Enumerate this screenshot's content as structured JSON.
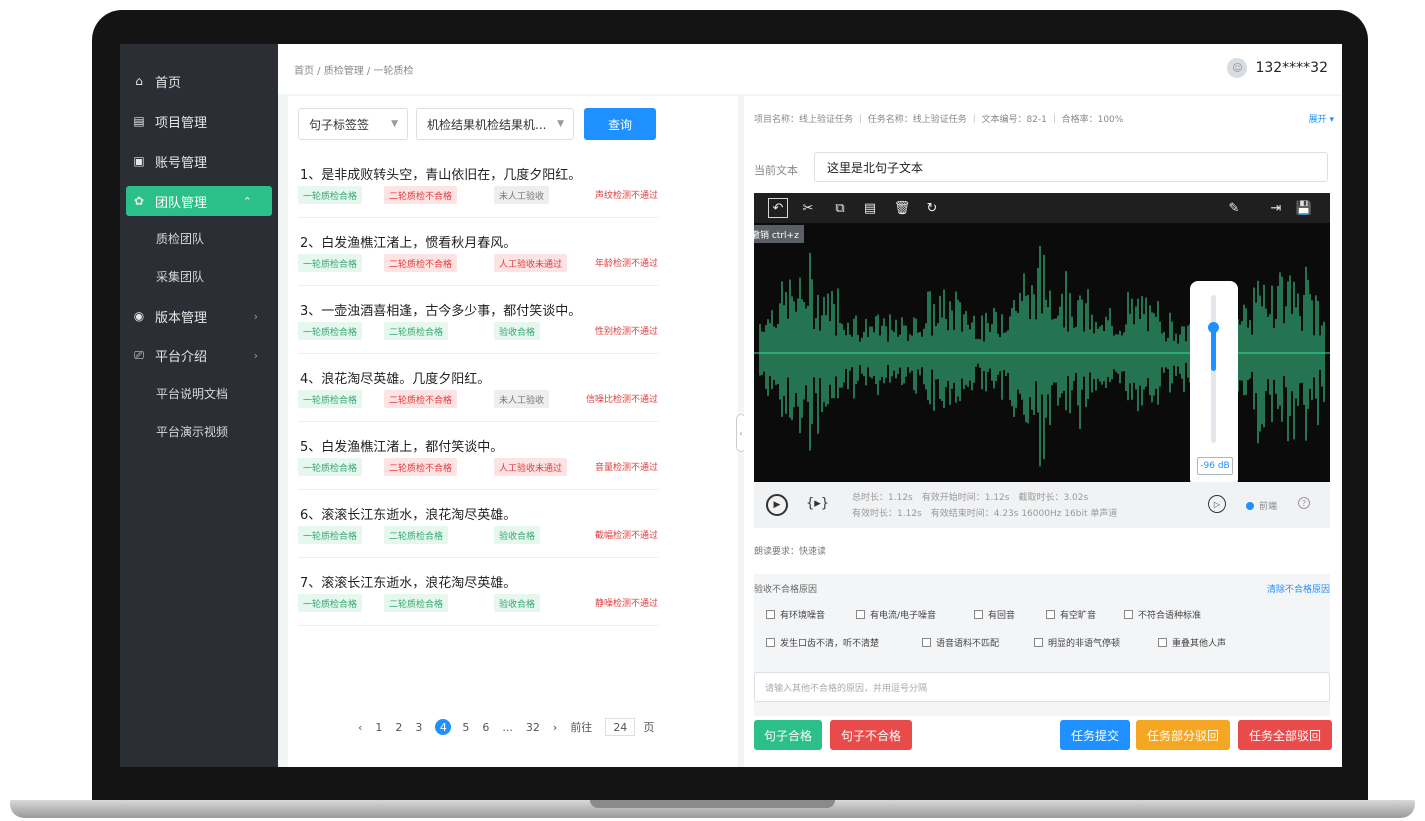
{
  "sidebar": {
    "items": [
      {
        "label": "首页",
        "icon": "home-icon"
      },
      {
        "label": "项目管理",
        "icon": "project-icon"
      },
      {
        "label": "账号管理",
        "icon": "account-icon"
      },
      {
        "label": "团队管理",
        "icon": "team-icon"
      },
      {
        "label": "质检团队"
      },
      {
        "label": "采集团队"
      },
      {
        "label": "版本管理",
        "icon": "version-icon"
      },
      {
        "label": "平台介绍",
        "icon": "platform-icon"
      },
      {
        "label": "平台说明文档"
      },
      {
        "label": "平台演示视频"
      }
    ],
    "active_color": "#2bbf8a"
  },
  "header": {
    "breadcrumb": "首页 / 质检管理 / 一轮质检",
    "user": "132****32"
  },
  "filter": {
    "select1": "句子标签签",
    "select2": "机检结果机检结果机...",
    "query": "查询"
  },
  "sentences": [
    {
      "text": "1、是非成败转头空，青山依旧在，几度夕阳红。",
      "tags": [
        "一轮质检合格",
        "二轮质检不合格",
        "未人工验收"
      ],
      "result": "声纹检测不通过"
    },
    {
      "text": "2、白发渔樵江渚上，惯看秋月春风。",
      "tags": [
        "一轮质检合格",
        "二轮质检不合格",
        "人工验收未通过"
      ],
      "result": "年龄检测不通过"
    },
    {
      "text": "3、一壶浊酒喜相逢，古今多少事，都付笑谈中。",
      "tags": [
        "一轮质检合格",
        "二轮质检合格",
        "验收合格"
      ],
      "result": "性别检测不通过"
    },
    {
      "text": "4、浪花淘尽英雄。几度夕阳红。",
      "tags": [
        "一轮质检合格",
        "二轮质检不合格",
        "未人工验收"
      ],
      "result": "信噪比检测不通过"
    },
    {
      "text": "5、白发渔樵江渚上，都付笑谈中。",
      "tags": [
        "一轮质检合格",
        "二轮质检不合格",
        "人工验收未通过"
      ],
      "result": "音量检测不通过"
    },
    {
      "text": "6、滚滚长江东逝水，浪花淘尽英雄。",
      "tags": [
        "一轮质检合格",
        "二轮质检合格",
        "验收合格"
      ],
      "result": "截幅检测不通过"
    },
    {
      "text": "7、滚滚长江东逝水，浪花淘尽英雄。",
      "tags": [
        "一轮质检合格",
        "二轮质检合格",
        "验收合格"
      ],
      "result": "静噪检测不通过"
    }
  ],
  "pager": {
    "pages": [
      "1",
      "2",
      "3",
      "4",
      "5",
      "6",
      "...",
      "32"
    ],
    "current": "4",
    "goto_label": "前往",
    "goto_value": "24",
    "page_unit": "页"
  },
  "detail": {
    "project": "项目名称：线上验证任务 ｜ 任务名称：线上验证任务 ｜ 文本编号：82-1 ｜ 合格率：100%",
    "expand": "展开",
    "current_label": "当前文本",
    "current_text": "这里是北句子文本",
    "tooltip": "撤销 ctrl+z",
    "db": "-96 dB",
    "stats_line1": "总时长：1.12s　有效开始时间：1.12s　截取时长：3.02s",
    "stats_line2": "有效时长：1.12s　有效结束时间：4.23s 16000Hz 16bit 单声道",
    "radio": "前端",
    "reading": "朗读要求：快速读",
    "reasons_title": "验收不合格原因",
    "clear": "清除不合格原因",
    "reasons": [
      "有环境噪音",
      "有电流/电子噪音",
      "有回音",
      "有空旷音",
      "不符合语种标准",
      "发生口齿不清，听不清楚",
      "语音语料不匹配",
      "明显的非语气停顿",
      "重叠其他人声"
    ],
    "other_placeholder": "请输入其他不合格的原因，并用逗号分隔"
  },
  "actions": {
    "pass": "句子合格",
    "fail": "句子不合格",
    "submit": "任务提交",
    "partial": "任务部分驳回",
    "all": "任务全部驳回"
  },
  "colors": {
    "primary": "#1e90ff",
    "green": "#2bbf8a",
    "red": "#e94b4b",
    "orange": "#f5a623",
    "wave": "#3ddc97"
  }
}
